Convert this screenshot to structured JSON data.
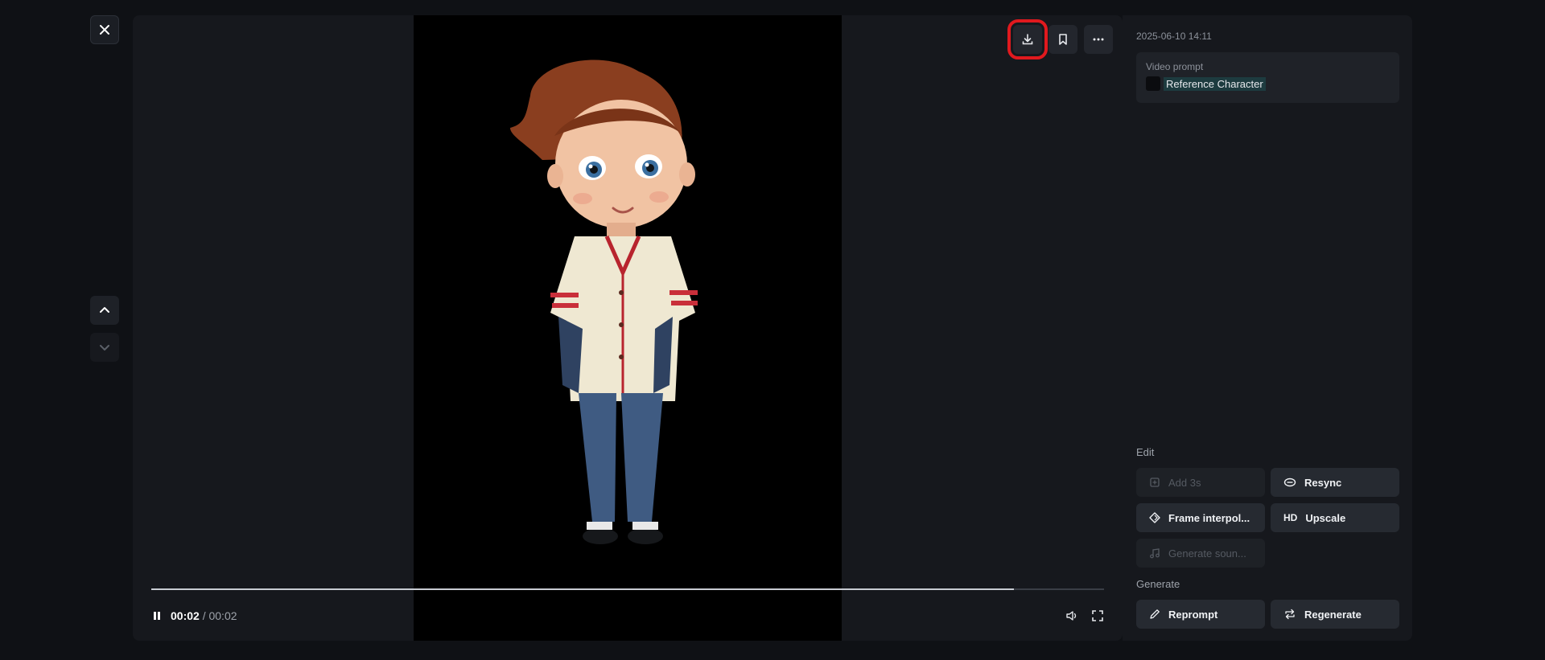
{
  "left": {
    "close_icon": "close-icon",
    "nav_up_icon": "chevron-up-icon",
    "nav_down_icon": "chevron-down-icon"
  },
  "player": {
    "actions": [
      "download-icon",
      "bookmark-icon",
      "more-icon"
    ],
    "progress": 0.905,
    "time_current": "00:02",
    "time_separator": " / ",
    "time_total": "00:02"
  },
  "side": {
    "timestamp": "2025-06-10 14:11",
    "prompt_label": "Video prompt",
    "prompt_chip": "Reference Character",
    "edit_label": "Edit",
    "edit_buttons": {
      "add": "Add 3s",
      "resync": "Resync",
      "frame": "Frame interpol...",
      "upscale_prefix": "HD",
      "upscale": "Upscale",
      "sound": "Generate soun..."
    },
    "generate_label": "Generate",
    "generate_buttons": {
      "reprompt": "Reprompt",
      "regenerate": "Regenerate"
    }
  },
  "colors": {
    "background": "#0f1115",
    "panel": "#16181d",
    "highlight": "#e0191e",
    "chip": "#1d3b3f"
  }
}
